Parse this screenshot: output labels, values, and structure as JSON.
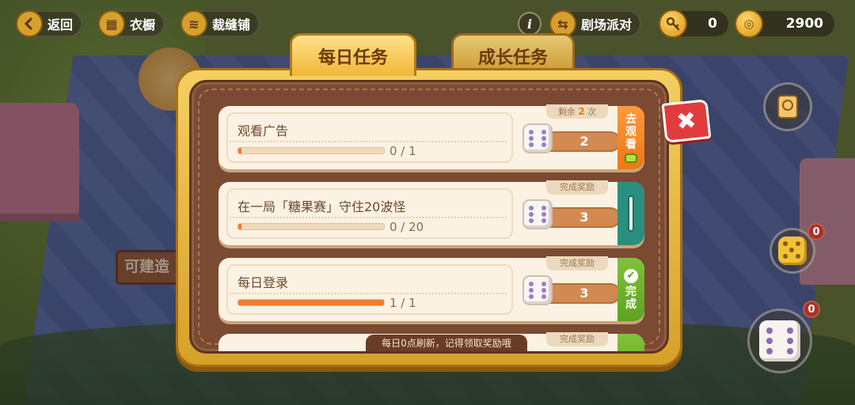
{
  "topbar": {
    "back_label": "返回",
    "wardrobe_label": "衣橱",
    "tailor_label": "裁缝铺",
    "party_label": "剧场派对",
    "info_label": "i"
  },
  "currency": {
    "keys": "0",
    "coins": "2900"
  },
  "side": {
    "dice_badge_1": "0",
    "dice_badge_2": "0"
  },
  "dialog": {
    "tabs": [
      {
        "label": "每日任务",
        "active": true
      },
      {
        "label": "成长任务",
        "active": false
      }
    ],
    "footer_note": "每日0点刷新，记得领取奖励哦",
    "tasks": [
      {
        "title": "观看广告",
        "progress_text": "0 / 1",
        "progress_fraction": 0,
        "caption_prefix": "剩余",
        "caption_count": "2",
        "caption_suffix": "次",
        "reward": "2",
        "action_label": "去观看",
        "action_state": "watch"
      },
      {
        "title": "在一局「糖果赛」守住20波怪",
        "progress_text": "0 / 20",
        "progress_fraction": 0,
        "caption": "完成奖励",
        "reward": "3",
        "action_state": "locked"
      },
      {
        "title": "每日登录",
        "progress_text": "1 / 1",
        "progress_fraction": 1,
        "caption": "完成奖励",
        "reward": "3",
        "action_label": "完成",
        "action_state": "done"
      },
      {
        "caption": "完成奖励"
      }
    ]
  },
  "background": {
    "sign_text": "可建造"
  },
  "colors": {
    "accent_orange": "#f27a2a",
    "done_green": "#6fb52c",
    "locked_teal": "#2b8f7f",
    "close_red": "#e23b3b"
  }
}
